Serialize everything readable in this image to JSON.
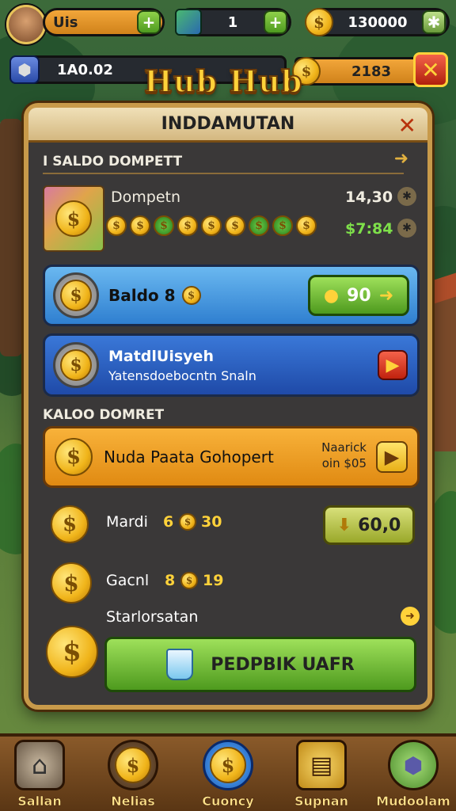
{
  "top": {
    "player_name": "Uis",
    "gems": "1",
    "coins": "130000",
    "level_value": "1A0.02",
    "gold_value": "2183"
  },
  "title": "Hub Hub",
  "panel": {
    "header": "INDDAMUTAN",
    "section1": "I SALDO DOMPETT",
    "wallet_label": "Dompetn",
    "wallet_value1": "14,30",
    "wallet_value2": "$7:84",
    "balance_label": "Baldo 8",
    "balance_button": "90",
    "card2_title": "MatdlUisyeh",
    "card2_subtitle": "Yatensdoebocntn Snaln",
    "section2": "KALOO DOMRET",
    "orange_title": "Nuda Paata Gohopert",
    "orange_note_line1": "Naarick",
    "orange_note_line2": "oin $05",
    "row1_label": "Mardi",
    "row1_value_a": "6",
    "row1_value_b": "30",
    "row1_button": "60,0",
    "row2_label": "Gacnl",
    "row2_value_a": "8",
    "row2_value_b": "19",
    "row3_label": "Starlorsatan",
    "big_button": "PEDPBIK UAFR"
  },
  "nav": [
    {
      "label": "Sallan"
    },
    {
      "label": "Nelias"
    },
    {
      "label": "Cuoncy"
    },
    {
      "label": "Supnan"
    },
    {
      "label": "Mudoolam"
    }
  ],
  "colors": {
    "panel_border": "#c89a4a",
    "accent_gold": "#ffd23a",
    "button_green": "#4e9a1e",
    "card_blue": "#2f7fd0",
    "card_orange": "#e08a12"
  }
}
